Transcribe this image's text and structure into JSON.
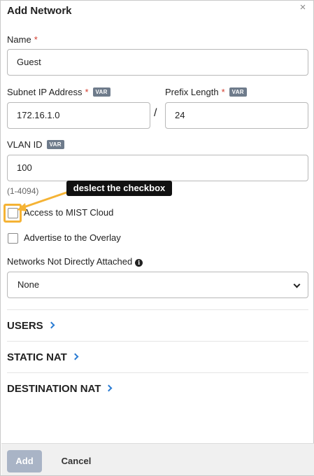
{
  "dialog": {
    "title": "Add Network",
    "close_glyph": "×"
  },
  "form": {
    "name": {
      "label": "Name",
      "required": "*",
      "value": "Guest"
    },
    "subnet": {
      "label": "Subnet IP Address",
      "required": "*",
      "badge": "VAR",
      "value": "172.16.1.0"
    },
    "separator": "/",
    "prefix": {
      "label": "Prefix Length",
      "required": "*",
      "badge": "VAR",
      "value": "24"
    },
    "vlan": {
      "label": "VLAN ID",
      "badge": "VAR",
      "value": "100",
      "hint": "(1-4094)"
    },
    "access_mist": {
      "label": "Access to MIST Cloud",
      "checked": false
    },
    "advertise_overlay": {
      "label": "Advertise to the Overlay",
      "checked": false
    },
    "networks_not_attached": {
      "label": "Networks Not Directly Attached",
      "info_icon": "info-icon",
      "value": "None"
    }
  },
  "sections": [
    {
      "label": "USERS"
    },
    {
      "label": "STATIC NAT"
    },
    {
      "label": "DESTINATION NAT"
    }
  ],
  "footer": {
    "add_label": "Add",
    "cancel_label": "Cancel"
  },
  "annotation": {
    "text": "deslect the checkbox",
    "highlight_color": "#f5b335"
  },
  "colors": {
    "required": "#d23b2d",
    "accent": "#2b7cd3",
    "add_button_disabled": "#a9b4c6"
  }
}
